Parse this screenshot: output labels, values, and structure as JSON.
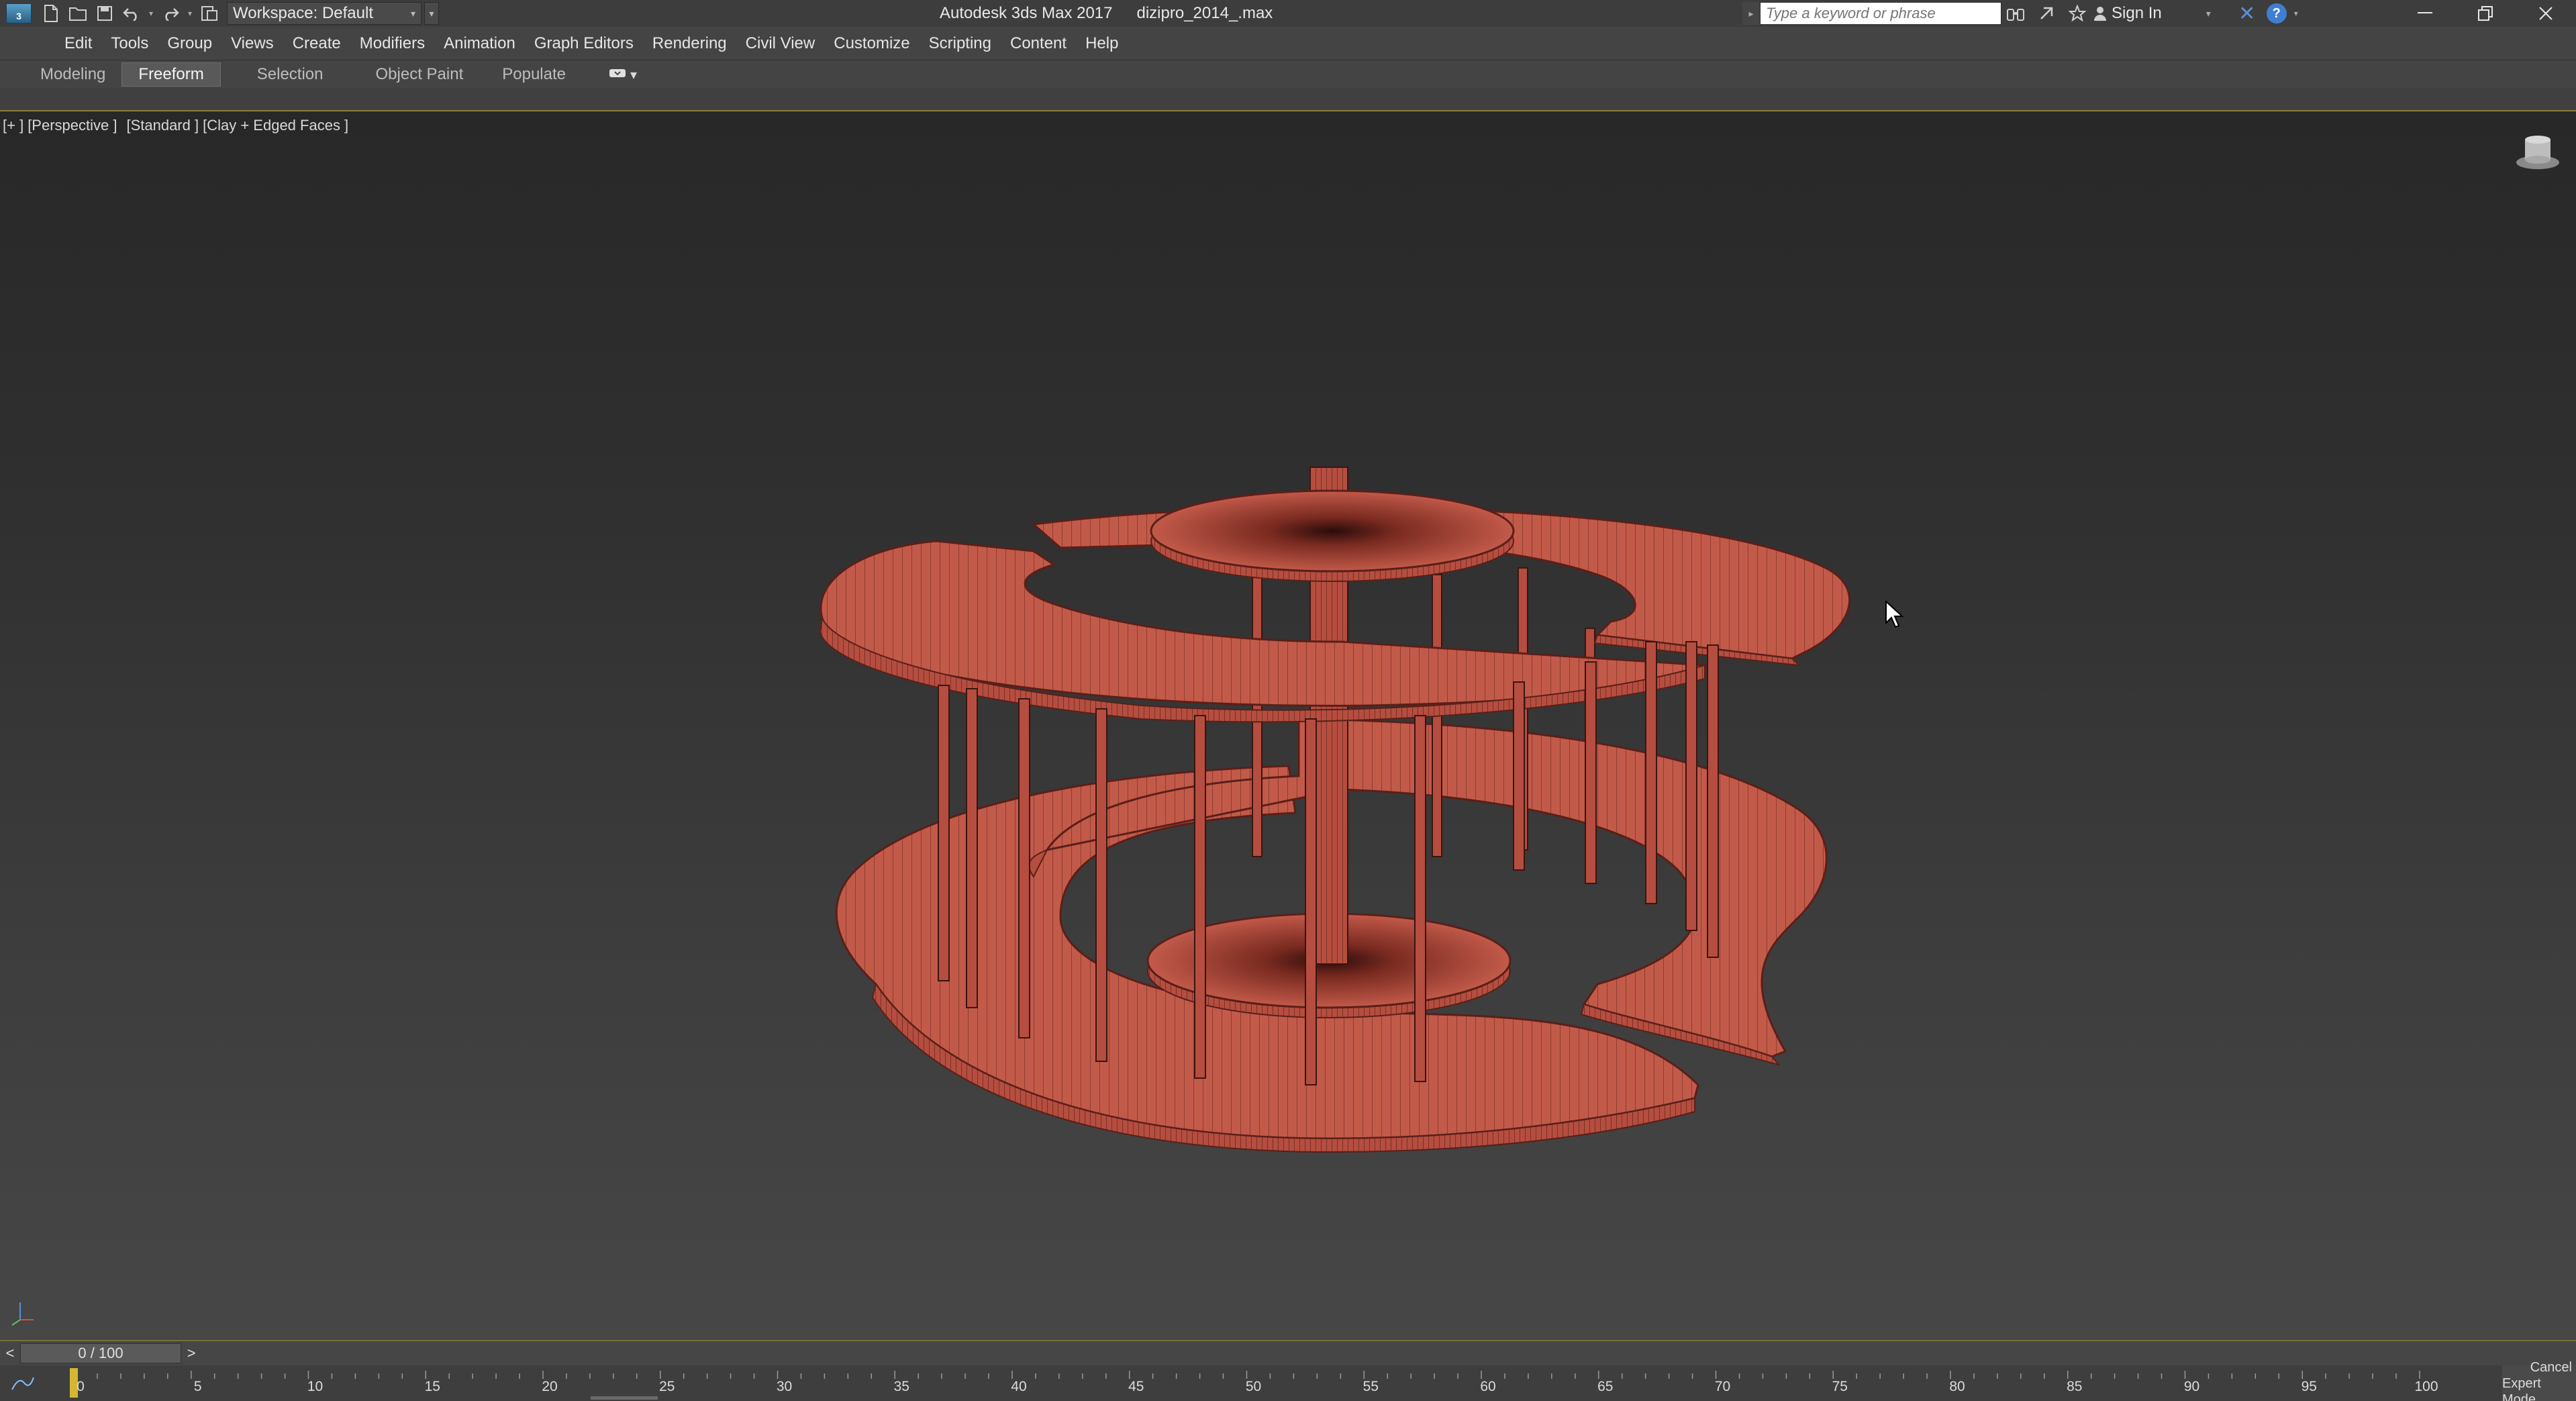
{
  "titlebar": {
    "app_name": "Autodesk 3ds Max 2017",
    "file_name": "dizipro_2014_.max",
    "workspace": "Workspace: Default",
    "search_placeholder": "Type a keyword or phrase",
    "signin_label": "Sign In",
    "logo_letter": "3",
    "quick_access_icons": [
      "new-file-icon",
      "open-file-icon",
      "save-icon",
      "undo-icon",
      "redo-icon",
      "project-icon"
    ],
    "window_controls": [
      "minimize",
      "restore",
      "close"
    ]
  },
  "menu": {
    "items": [
      "Edit",
      "Tools",
      "Group",
      "Views",
      "Create",
      "Modifiers",
      "Animation",
      "Graph Editors",
      "Rendering",
      "Civil View",
      "Customize",
      "Scripting",
      "Content",
      "Help"
    ]
  },
  "ribbon": {
    "tabs": [
      {
        "label": "Modeling",
        "active": false
      },
      {
        "label": "Freeform",
        "active": true
      },
      {
        "label": "Selection",
        "active": false
      },
      {
        "label": "Object Paint",
        "active": false
      },
      {
        "label": "Populate",
        "active": false
      }
    ]
  },
  "viewport": {
    "label_plus": "[+ ]",
    "label_view": "[Perspective ]",
    "label_shading_std": "[Standard ]",
    "label_shading_mode": "[Clay + Edged Faces ]",
    "model_color": "#c25a4a",
    "edge_color": "#5a1f18"
  },
  "timeline": {
    "prev": "<",
    "next": ">",
    "frame_display": "0 / 100",
    "ticks": [
      "0",
      "5",
      "10",
      "15",
      "20",
      "25",
      "30",
      "35",
      "40",
      "45",
      "50",
      "55",
      "60",
      "65",
      "70",
      "75",
      "80",
      "85",
      "90",
      "95",
      "100"
    ]
  },
  "status": {
    "cancel_label": "Cancel",
    "expert_label": "Expert Mode"
  }
}
